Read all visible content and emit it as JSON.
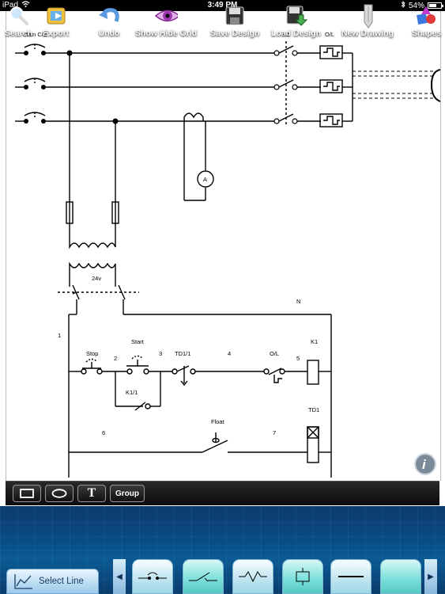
{
  "status": {
    "device": "iPad",
    "time": "3:49 PM",
    "battery": "54%"
  },
  "diagram": {
    "labels": {
      "main_cb": "Main C/B",
      "k1_top": "K1",
      "ol_top": "O/L",
      "ammeter": "A",
      "transformer_v": "24v",
      "n": "N",
      "wire1": "1",
      "stop": "Stop",
      "start": "Start",
      "wire2": "2",
      "wire3": "3",
      "td11": "TD1/1",
      "wire4": "4",
      "ol_ctrl": "O/L",
      "wire5": "5",
      "k1_coil": "K1",
      "k11": "K1/1",
      "td1": "TD1",
      "wire6": "6",
      "float": "Float",
      "wire7": "7"
    }
  },
  "toolbar": {
    "rect_tool": "rectangle",
    "ellipse_tool": "ellipse",
    "text_tool": "T",
    "group_label": "Group"
  },
  "menu": {
    "search": "Search",
    "export": "Export",
    "undo": "Undo",
    "show_hide_grid": "Show Hide Grid",
    "save_design": "Save Design",
    "load_design": "Load Design",
    "new_drawing": "New Drawing",
    "shapes": "Shapes"
  },
  "palette": {
    "select_line": "Select Line",
    "shapes": [
      "NC contact",
      "NO contact",
      "resistor",
      "coil",
      "wire"
    ]
  },
  "colors": {
    "accent_blue": "#0b5a95",
    "palette_teal": "#7fe0dc"
  }
}
